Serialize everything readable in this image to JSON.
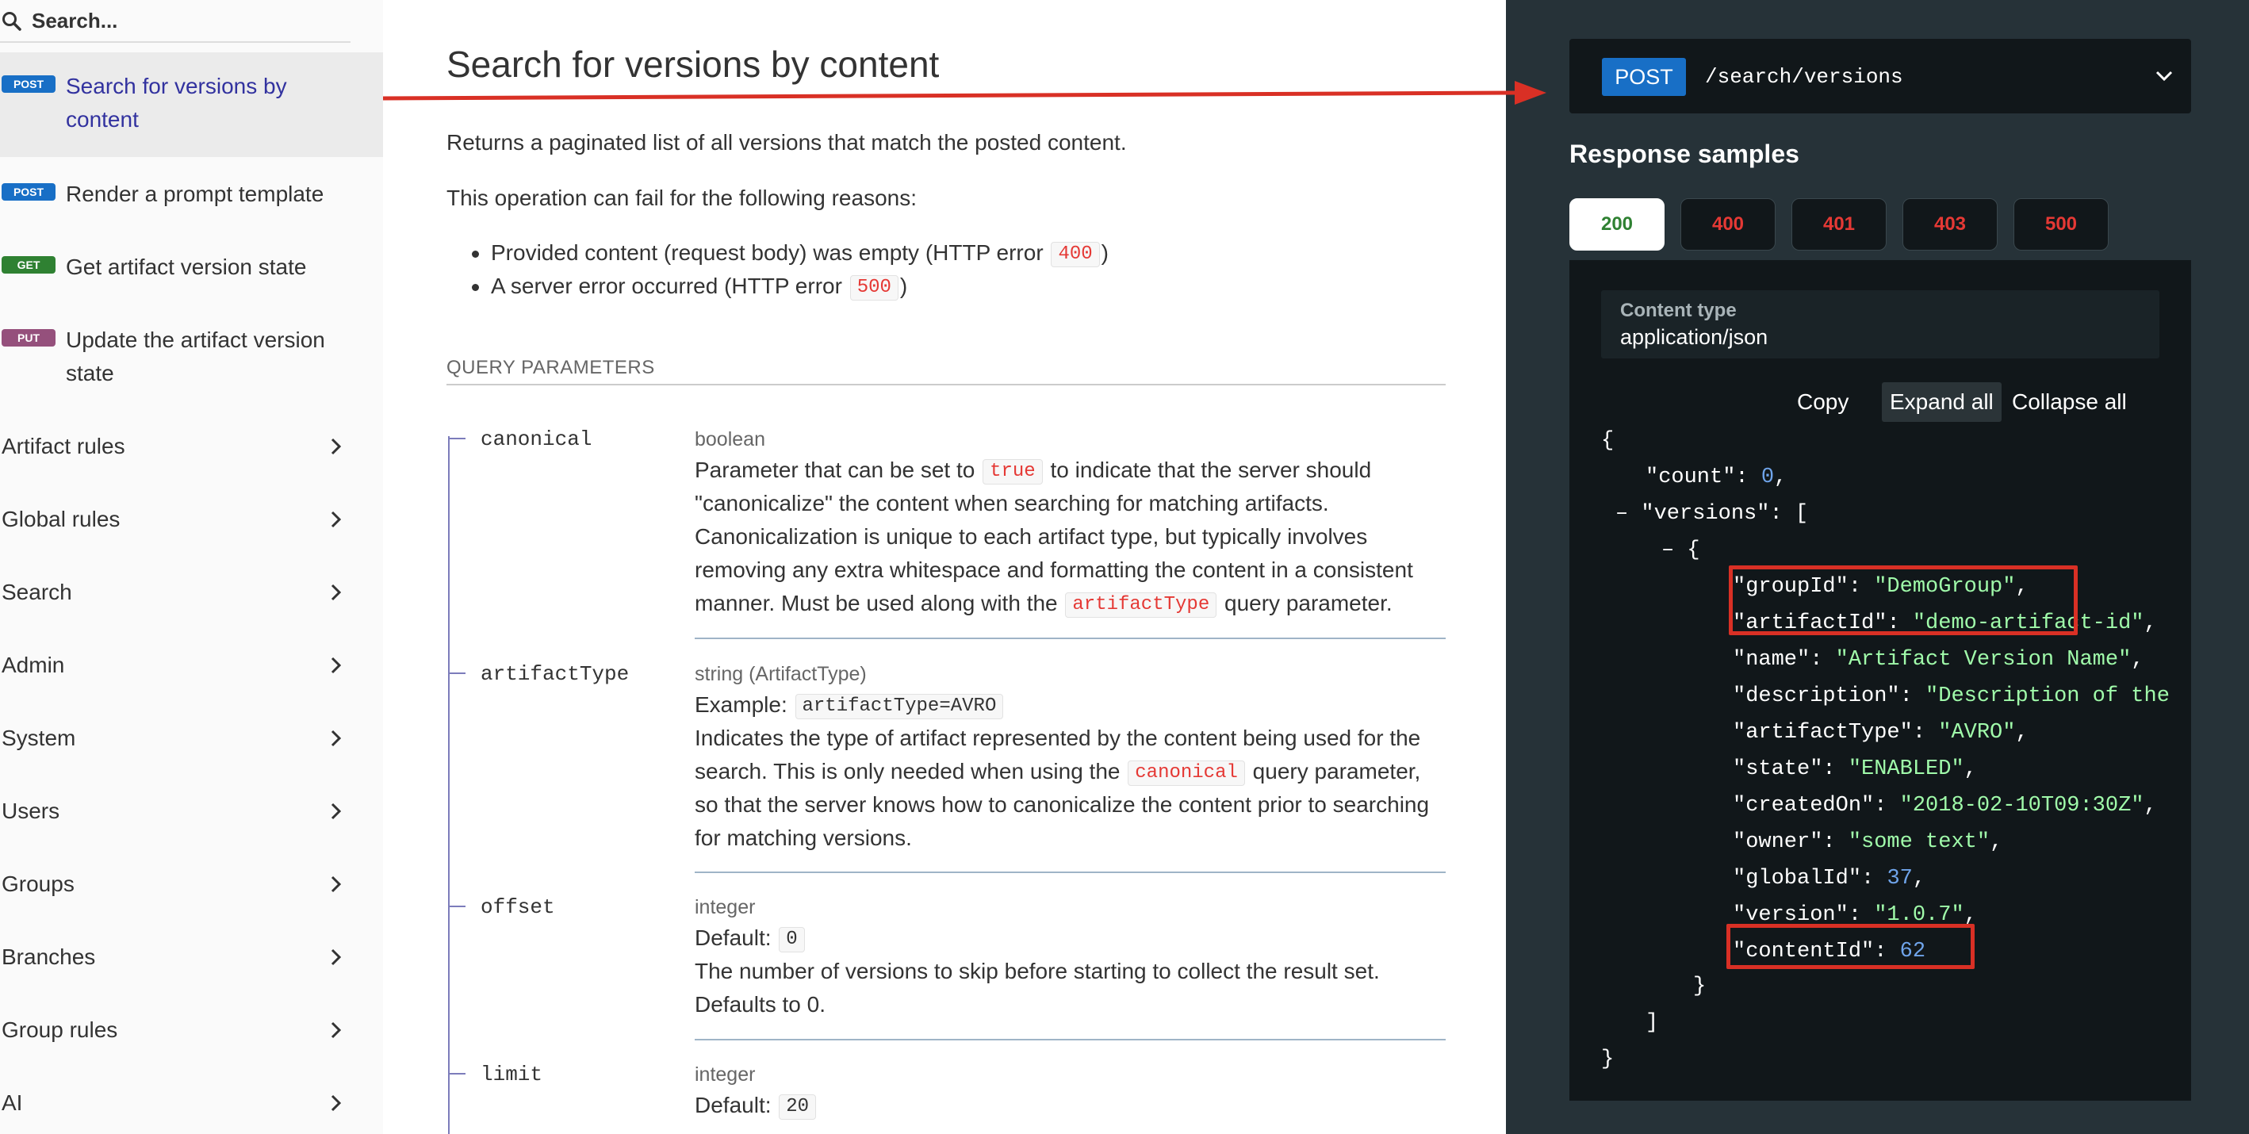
{
  "sidebar": {
    "search": {
      "placeholder": "Search..."
    },
    "operations": [
      {
        "method": "POST",
        "label_line1": "Search for versions by",
        "label_line2": "content",
        "active": true
      },
      {
        "method": "POST",
        "label_line1": "Render a prompt template"
      },
      {
        "method": "GET",
        "label_line1": "Get artifact version state"
      },
      {
        "method": "PUT",
        "label_line1": "Update the artifact version",
        "label_line2": "state"
      }
    ],
    "categories": [
      {
        "label": "Artifact rules"
      },
      {
        "label": "Global rules"
      },
      {
        "label": "Search"
      },
      {
        "label": "Admin"
      },
      {
        "label": "System"
      },
      {
        "label": "Users"
      },
      {
        "label": "Groups"
      },
      {
        "label": "Branches"
      },
      {
        "label": "Group rules"
      },
      {
        "label": "AI"
      }
    ]
  },
  "main": {
    "title": "Search for versions by content",
    "description": "Returns a paginated list of all versions that match the posted content.",
    "fail_intro": "This operation can fail for the following reasons:",
    "reasons": [
      {
        "text": "Provided content (request body) was empty (HTTP error ",
        "code": "400",
        "suffix": ")"
      },
      {
        "text": "A server error occurred (HTTP error ",
        "code": "500",
        "suffix": ")"
      }
    ],
    "query_params_header": "QUERY PARAMETERS",
    "params": [
      {
        "name": "canonical",
        "type": "boolean",
        "desc_1a": "Parameter that can be set to ",
        "desc_1code": "true",
        "desc_1b": " to indicate that the server should",
        "desc_2": "\"canonicalize\" the content when searching for matching artifacts.",
        "desc_3": "Canonicalization is unique to each artifact type, but typically involves",
        "desc_4": "removing any extra whitespace and formatting the content in a consistent",
        "desc_5a": "manner. Must be used along with the ",
        "desc_5code": "artifactType",
        "desc_5b": " query parameter."
      },
      {
        "name": "artifactType",
        "type": "string (ArtifactType)",
        "example_label": "Example: ",
        "example_value": "artifactType=AVRO",
        "desc_1": "Indicates the type of artifact represented by the content being used for the",
        "desc_2a": "search. This is only needed when using the ",
        "desc_2code": "canonical",
        "desc_2b": " query parameter,",
        "desc_3": "so that the server knows how to canonicalize the content prior to searching",
        "desc_4": "for matching versions."
      },
      {
        "name": "offset",
        "type": "integer",
        "default_label": "Default: ",
        "default_value": "0",
        "desc_1": "The number of versions to skip before starting to collect the result set.",
        "desc_2": "Defaults to 0."
      },
      {
        "name": "limit",
        "type": "integer",
        "default_label": "Default: ",
        "default_value": "20"
      }
    ]
  },
  "right": {
    "endpoint": {
      "method": "POST",
      "path": "/search/versions"
    },
    "response_title": "Response samples",
    "status_tabs": [
      "200",
      "400",
      "401",
      "403",
      "500"
    ],
    "active_tab": "200",
    "content_type_label": "Content type",
    "content_type_value": "application/json",
    "json_controls": {
      "copy": "Copy",
      "expand": "Expand all",
      "collapse": "Collapse all"
    },
    "json": {
      "open_brace": "{",
      "count_key": "\"count\"",
      "count_value": "0",
      "versions_key": "\"versions\"",
      "open_bracket": "[",
      "collapse_marker": "–",
      "obj_open": "{",
      "fields": [
        {
          "key": "\"groupId\"",
          "value": "\"DemoGroup\"",
          "kind": "string"
        },
        {
          "key": "\"artifactId\"",
          "value": "\"demo-artifact-id\"",
          "kind": "string"
        },
        {
          "key": "\"name\"",
          "value": "\"Artifact Version Name\"",
          "kind": "string"
        },
        {
          "key": "\"description\"",
          "value": "\"Description of the",
          "kind": "string"
        },
        {
          "key": "\"artifactType\"",
          "value": "\"AVRO\"",
          "kind": "string"
        },
        {
          "key": "\"state\"",
          "value": "\"ENABLED\"",
          "kind": "string"
        },
        {
          "key": "\"createdOn\"",
          "value": "\"2018-02-10T09:30Z\"",
          "kind": "string"
        },
        {
          "key": "\"owner\"",
          "value": "\"some text\"",
          "kind": "string"
        },
        {
          "key": "\"globalId\"",
          "value": "37",
          "kind": "number"
        },
        {
          "key": "\"version\"",
          "value": "\"1.0.7\"",
          "kind": "string"
        },
        {
          "key": "\"contentId\"",
          "value": "62",
          "kind": "number"
        }
      ],
      "obj_close": "}",
      "close_bracket": "]",
      "close_brace": "}"
    }
  },
  "colors": {
    "accent": "#32329f",
    "post": "#186fc6",
    "get": "#2f8132",
    "put": "#95507c",
    "annotation": "#d93025",
    "json_string": "#a0fbaa",
    "json_number": "#6fa4ea"
  }
}
